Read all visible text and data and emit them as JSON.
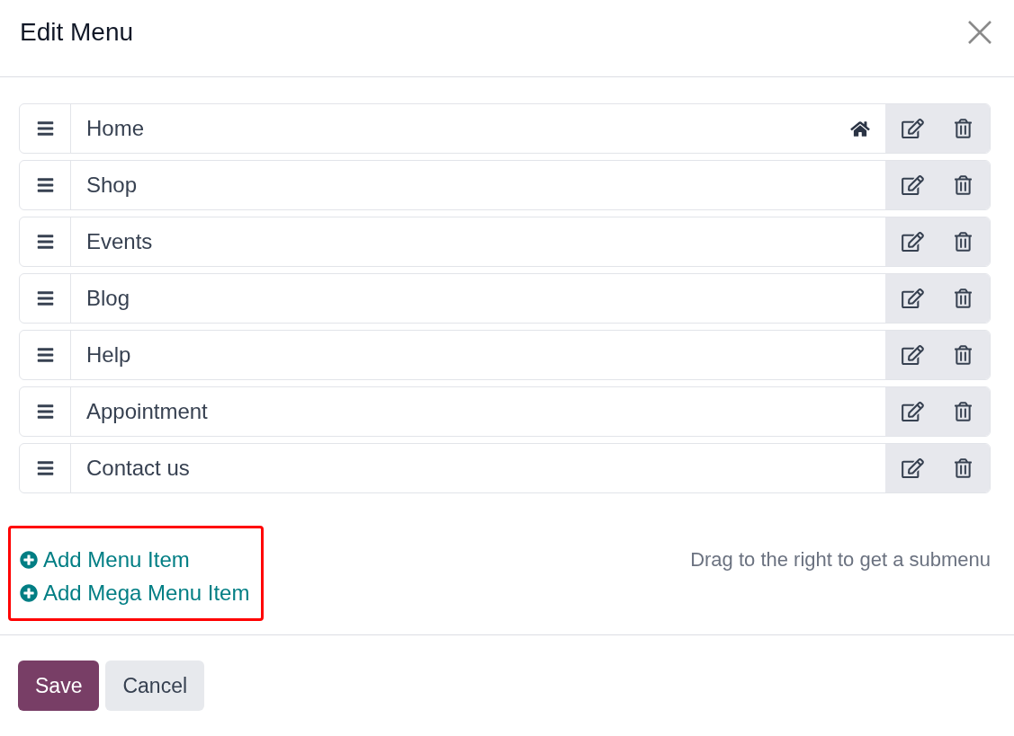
{
  "dialog": {
    "title": "Edit Menu"
  },
  "menu_items": [
    {
      "label": "Home",
      "home": true
    },
    {
      "label": "Shop",
      "home": false
    },
    {
      "label": "Events",
      "home": false
    },
    {
      "label": "Blog",
      "home": false
    },
    {
      "label": "Help",
      "home": false
    },
    {
      "label": "Appointment",
      "home": false
    },
    {
      "label": "Contact us",
      "home": false
    }
  ],
  "add_actions": {
    "highlighted": true,
    "links": [
      "Add Menu Item",
      "Add Mega Menu Item"
    ]
  },
  "hint": "Drag to the right to get a submenu",
  "buttons": [
    {
      "label": "Save",
      "kind": "primary"
    },
    {
      "label": "Cancel",
      "kind": "secondary"
    }
  ]
}
